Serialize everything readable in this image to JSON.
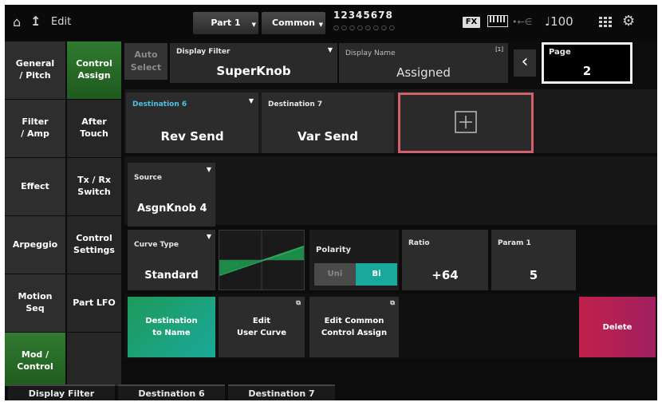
{
  "topbar": {
    "home_icon": "home-icon",
    "back_icon": "up-arrow-icon",
    "title": "Edit",
    "part": "Part 1",
    "common": "Common",
    "part_numbers": "12345678",
    "part_dots": "○○○○○○○○",
    "fx": "FX",
    "keyboard_icon": "keyboard-icon",
    "usb_icon": "usb-icon",
    "tempo_icon": "quarter-note-icon",
    "tempo": "100",
    "grid_icon": "grid-icon",
    "settings_icon": "gear-icon"
  },
  "left_menu": [
    {
      "label": "General\n/ Pitch",
      "selected": false
    },
    {
      "label": "Filter\n/ Amp",
      "selected": false
    },
    {
      "label": "Effect",
      "selected": false
    },
    {
      "label": "Arpeggio",
      "selected": false
    },
    {
      "label": "Motion\nSeq",
      "selected": false
    },
    {
      "label": "Mod /\nControl",
      "selected": true
    }
  ],
  "sub_menu": [
    {
      "label": "Control\nAssign",
      "selected": true
    },
    {
      "label": "After\nTouch",
      "selected": false
    },
    {
      "label": "Tx / Rx\nSwitch",
      "selected": false
    },
    {
      "label": "Control\nSettings",
      "selected": false
    },
    {
      "label": "Part LFO",
      "selected": false
    },
    {
      "label": "",
      "selected": false
    }
  ],
  "header": {
    "auto_select": "Auto\nSelect",
    "display_filter_label": "Display Filter",
    "display_filter_value": "SuperKnob",
    "display_name_label": "Display Name",
    "display_name_value": "Assigned",
    "display_name_badge": "[1]",
    "page_label": "Page",
    "page_value": "2",
    "prev_icon": "chevron-left-icon"
  },
  "destinations": [
    {
      "label": "Destination 6",
      "value": "Rev Send",
      "highlight": true
    },
    {
      "label": "Destination 7",
      "value": "Var Send",
      "highlight": false
    }
  ],
  "add_icon": "plus-icon",
  "source": {
    "label": "Source",
    "value": "AsgnKnob 4"
  },
  "curve": {
    "label": "Curve Type",
    "value": "Standard"
  },
  "polarity": {
    "label": "Polarity",
    "options": [
      "Uni",
      "Bi"
    ],
    "selected": "Bi"
  },
  "ratio": {
    "label": "Ratio",
    "value": "+64"
  },
  "param1": {
    "label": "Param 1",
    "value": "5"
  },
  "actions": {
    "dest_to_name": "Destination\nto Name",
    "edit_user_curve": "Edit\nUser Curve",
    "edit_common": "Edit Common\nControl Assign",
    "delete": "Delete",
    "external_icon": "external-window-icon"
  },
  "bottom_tabs": [
    "Display Filter",
    "Destination 6",
    "Destination 7"
  ],
  "colors": {
    "accent_green": "#2f7a2f",
    "teal": "#1aa89a",
    "highlight_red": "#d0606a",
    "delete_red": "#c0204a",
    "label_cyan": "#49c3e6"
  }
}
